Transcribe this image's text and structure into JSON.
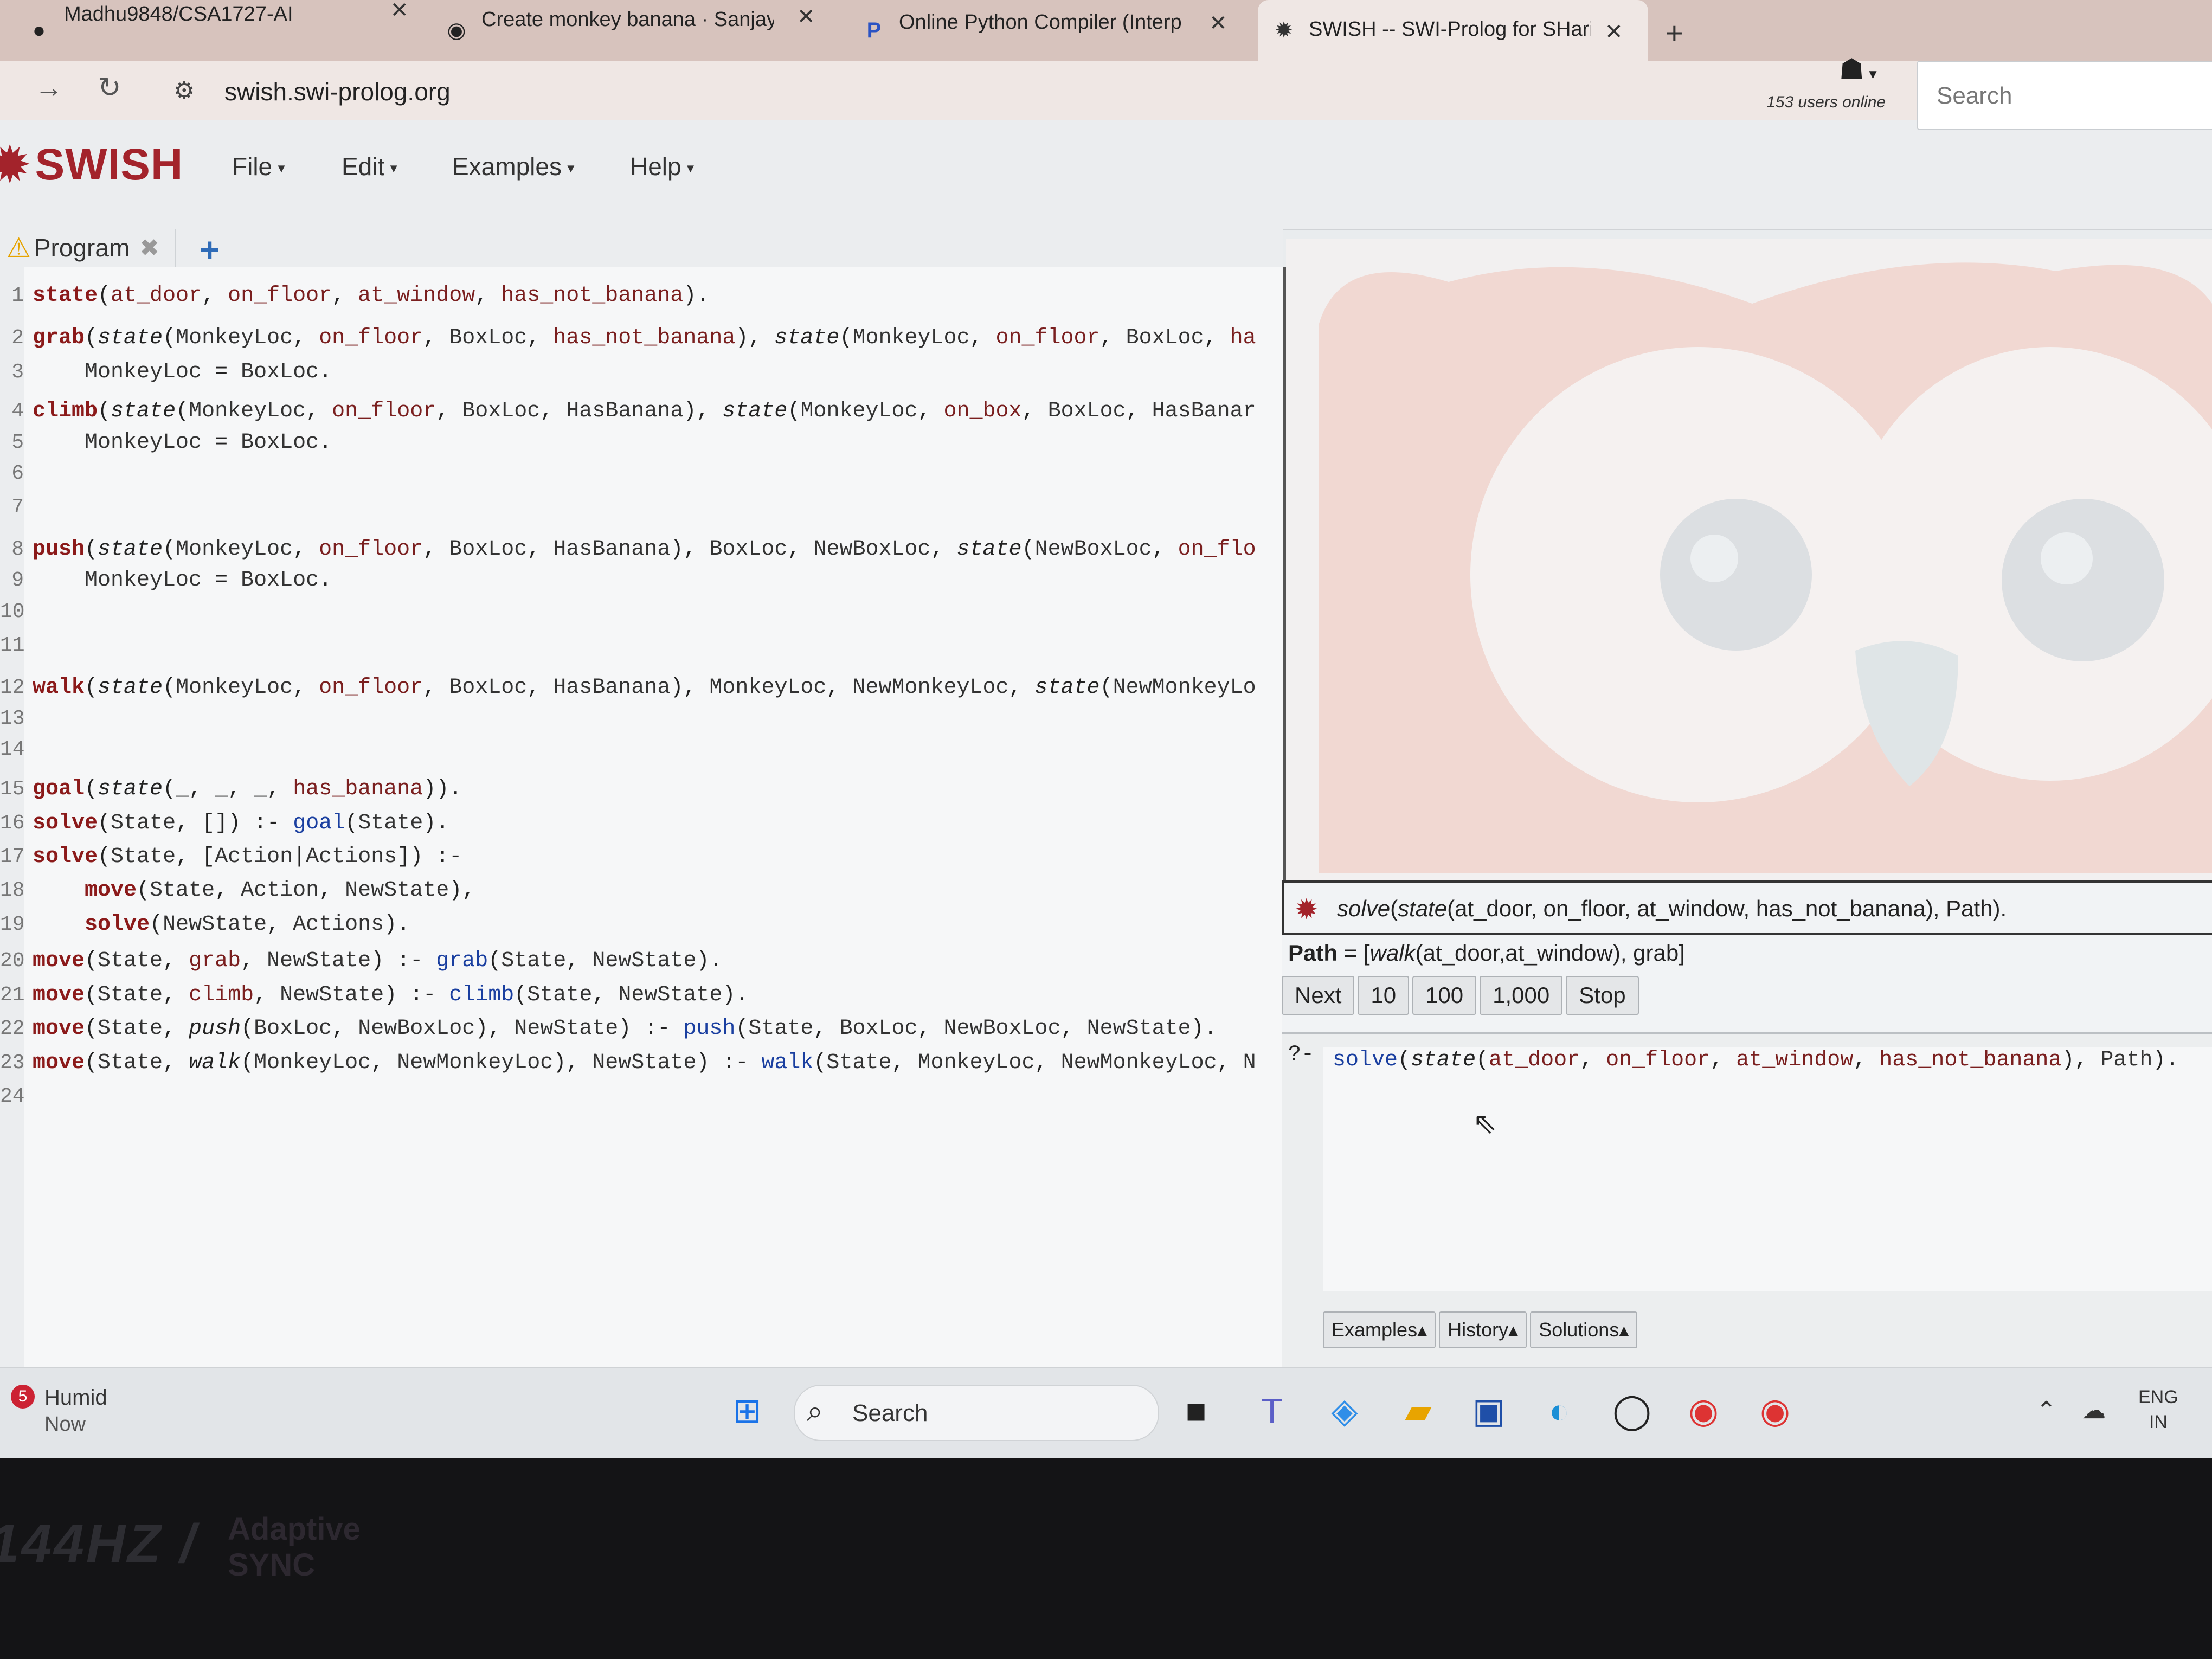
{
  "browser": {
    "tabs": [
      {
        "label": "Madhu9848/CSA1727-AI",
        "icon": "github-icon"
      },
      {
        "label": "Create monkey banana · Sanjay",
        "icon": "github-icon"
      },
      {
        "label": "Online Python Compiler (Interp",
        "icon": "programiz-icon"
      },
      {
        "label": "SWISH -- SWI-Prolog for SHarin",
        "icon": "swish-icon",
        "active": true
      }
    ],
    "close_glyph": "✕",
    "new_tab_glyph": "+",
    "url": "swish.swi-prolog.org"
  },
  "swish": {
    "logo_text": "SWISH",
    "menu": [
      {
        "label": "File"
      },
      {
        "label": "Edit"
      },
      {
        "label": "Examples"
      },
      {
        "label": "Help"
      }
    ],
    "users_online": "153 users online",
    "search_placeholder": "Search",
    "program_tab_label": "Program",
    "add_tab_glyph": "+",
    "code_lines": [
      {
        "n": "1",
        "code": "state(at_door, on_floor, at_window, has_not_banana)."
      },
      {
        "n": "2",
        "code": "grab(state(MonkeyLoc, on_floor, BoxLoc, has_not_banana), state(MonkeyLoc, on_floor, BoxLoc, ha"
      },
      {
        "n": "3",
        "code": "    MonkeyLoc = BoxLoc."
      },
      {
        "n": "4",
        "code": "climb(state(MonkeyLoc, on_floor, BoxLoc, HasBanana), state(MonkeyLoc, on_box, BoxLoc, HasBanar"
      },
      {
        "n": "5",
        "code": "    MonkeyLoc = BoxLoc."
      },
      {
        "n": "6",
        "code": ""
      },
      {
        "n": "7",
        "code": ""
      },
      {
        "n": "8",
        "code": "push(state(MonkeyLoc, on_floor, BoxLoc, HasBanana), BoxLoc, NewBoxLoc, state(NewBoxLoc, on_flo"
      },
      {
        "n": "9",
        "code": "    MonkeyLoc = BoxLoc."
      },
      {
        "n": "10",
        "code": ""
      },
      {
        "n": "11",
        "code": ""
      },
      {
        "n": "12",
        "code": "walk(state(MonkeyLoc, on_floor, BoxLoc, HasBanana), MonkeyLoc, NewMonkeyLoc, state(NewMonkeyLo"
      },
      {
        "n": "13",
        "code": ""
      },
      {
        "n": "14",
        "code": ""
      },
      {
        "n": "15",
        "code": "goal(state(_, _, _, has_banana))."
      },
      {
        "n": "16",
        "code": "solve(State, []) :- goal(State)."
      },
      {
        "n": "17",
        "code": "solve(State, [Action|Actions]) :-"
      },
      {
        "n": "18",
        "code": "    move(State, Action, NewState),"
      },
      {
        "n": "19",
        "code": "    solve(NewState, Actions)."
      },
      {
        "n": "20",
        "code": "move(State, grab, NewState) :- grab(State, NewState)."
      },
      {
        "n": "21",
        "code": "move(State, climb, NewState) :- climb(State, NewState)."
      },
      {
        "n": "22",
        "code": "move(State, push(BoxLoc, NewBoxLoc), NewState) :- push(State, BoxLoc, NewBoxLoc, NewState)."
      },
      {
        "n": "23",
        "code": "move(State, walk(MonkeyLoc, NewMonkeyLoc), NewState) :- walk(State, MonkeyLoc, NewMonkeyLoc, N"
      },
      {
        "n": "24",
        "code": ""
      }
    ],
    "query_header": "solve(state(at_door, on_floor, at_window, has_not_banana), Path).",
    "answer_var": "Path",
    "answer_value": " = [walk(at_door,at_window), grab]",
    "answer_buttons": [
      "Next",
      "10",
      "100",
      "1,000",
      "Stop"
    ],
    "query_prompt": "?-",
    "query_input": "solve(state(at_door, on_floor, at_window, has_not_banana), Path).",
    "query_buttons": [
      "Examples▴",
      "History▴",
      "Solutions▴"
    ]
  },
  "taskbar": {
    "weather_badge": "5",
    "weather_title": "Humid",
    "weather_sub": "Now",
    "search_label": "Search",
    "icons": [
      "windows-start-icon",
      "task-view-icon",
      "teams-icon",
      "copilot-icon",
      "file-explorer-icon",
      "store-icon",
      "edge-icon",
      "whatsapp-icon",
      "chrome-icon",
      "chrome-profile-icon"
    ],
    "lang_line1": "ENG",
    "lang_line2": "IN"
  },
  "bezel": {
    "refresh_text": "144HZ /",
    "sync_line1": "Adaptive",
    "sync_line2": "SYNC"
  },
  "colors": {
    "swish_red": "#a3232b",
    "keyword": "#8b1a1a",
    "builtin": "#1a3fa0"
  }
}
